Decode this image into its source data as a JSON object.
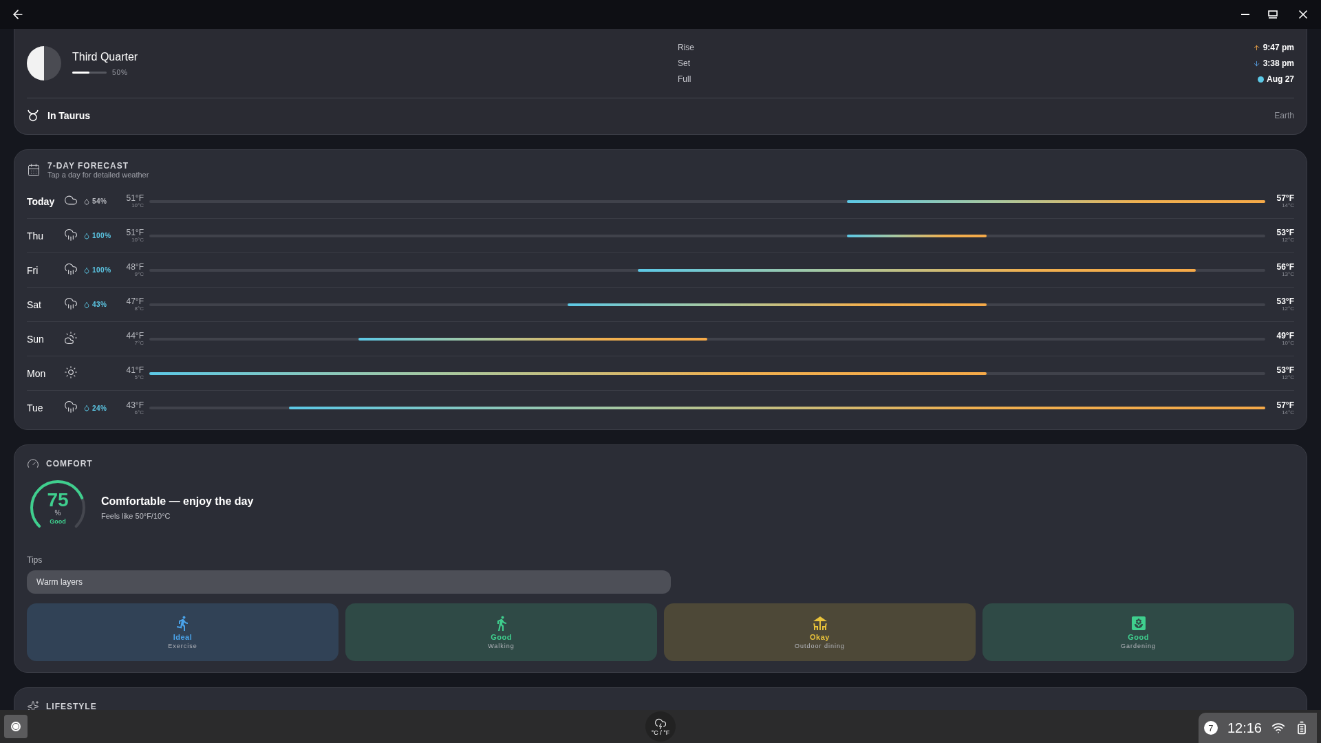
{
  "moon": {
    "phase": "Third Quarter",
    "illumination": "50%",
    "level": 0.5,
    "events": [
      {
        "kind": "rise",
        "label": "Rise",
        "value": "9:47 pm"
      },
      {
        "kind": "set",
        "label": "Set",
        "value": "3:38 pm"
      },
      {
        "kind": "full",
        "label": "Full",
        "value": "Aug 27"
      }
    ],
    "zodiac": "In Taurus",
    "element": "Earth"
  },
  "forecast": {
    "title": "7-DAY FORECAST",
    "subtitle": "Tap a day for detailed weather",
    "days": [
      {
        "day": "Today",
        "current": true,
        "kind": "cloudy",
        "precip": "54%",
        "low_f": "51°F",
        "low_c": "10°C",
        "high_f": "57°F",
        "high_c": "14°C"
      },
      {
        "day": "Thu",
        "current": false,
        "kind": "rain",
        "precip": "100%",
        "low_f": "51°F",
        "low_c": "10°C",
        "high_f": "53°F",
        "high_c": "12°C"
      },
      {
        "day": "Fri",
        "current": false,
        "kind": "rain",
        "precip": "100%",
        "low_f": "48°F",
        "low_c": "9°C",
        "high_f": "56°F",
        "high_c": "13°C"
      },
      {
        "day": "Sat",
        "current": false,
        "kind": "rain",
        "precip": "43%",
        "low_f": "47°F",
        "low_c": "8°C",
        "high_f": "53°F",
        "high_c": "12°C"
      },
      {
        "day": "Sun",
        "current": false,
        "kind": "partly_sunny",
        "low_f": "44°F",
        "low_c": "7°C",
        "high_f": "49°F",
        "high_c": "10°C"
      },
      {
        "day": "Mon",
        "current": false,
        "kind": "sunny",
        "low_f": "41°F",
        "low_c": "5°C",
        "high_f": "53°F",
        "high_c": "12°C"
      },
      {
        "day": "Tue",
        "current": false,
        "kind": "rain",
        "precip": "24%",
        "low_f": "43°F",
        "low_c": "6°C",
        "high_f": "57°F",
        "high_c": "14°C"
      }
    ]
  },
  "comfort": {
    "title": "COMFORT",
    "score": "75",
    "unit": "%",
    "rating": "Good",
    "level": 0.75,
    "headline": "Comfortable — enjoy the day",
    "feels_like": "Feels like 50°F/10°C",
    "tips_label": "Tips",
    "tips": [
      "Warm layers"
    ],
    "activities": [
      {
        "kind": "exercise",
        "status": "Ideal",
        "name": "Exercise",
        "color": "#4aa3ea"
      },
      {
        "kind": "walking",
        "status": "Good",
        "name": "Walking",
        "color": "#3fcf8e"
      },
      {
        "kind": "dining",
        "status": "Okay",
        "name": "Outdoor dining",
        "color": "#e8c23a"
      },
      {
        "kind": "gardening",
        "status": "Good",
        "name": "Gardening",
        "color": "#3fcf8e"
      }
    ]
  },
  "lifestyle": {
    "title": "LIFESTYLE"
  },
  "taskbar": {
    "app_label": "°C / °F",
    "notifications": "7",
    "time": "12:16"
  }
}
